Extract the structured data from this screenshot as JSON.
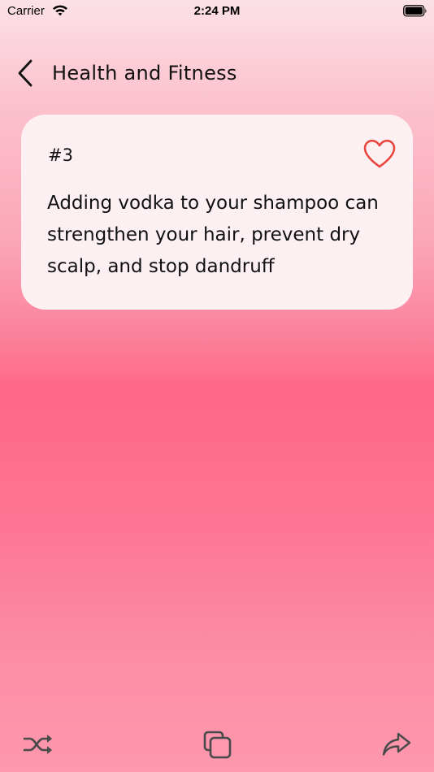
{
  "status_bar": {
    "carrier": "Carrier",
    "time": "2:24 PM"
  },
  "nav": {
    "title": "Health and Fitness",
    "back_icon": "chevron-left-icon"
  },
  "fact": {
    "number": "#3",
    "text": "Adding vodka to your shampoo can strengthen your hair, prevent dry scalp, and stop dandruff",
    "favorite_icon": "heart-outline-icon",
    "favorited": false
  },
  "toolbar": {
    "items": [
      {
        "icon": "shuffle-icon"
      },
      {
        "icon": "copy-icon"
      },
      {
        "icon": "share-icon"
      }
    ]
  },
  "colors": {
    "heart": "#e8473f",
    "card": "#fdf0f2",
    "icon_gray": "#4a4a4a",
    "background_top": "#fde1e7",
    "background_mid": "#ff6786"
  }
}
